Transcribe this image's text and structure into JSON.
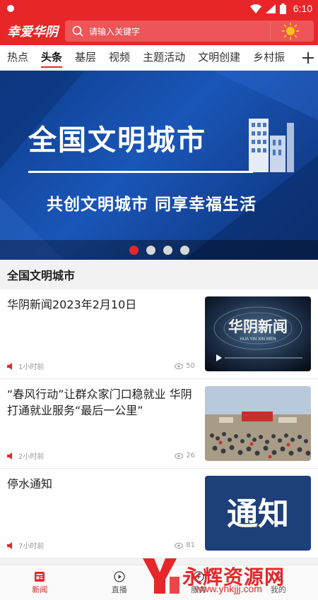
{
  "status_bar": {
    "time": "6:10"
  },
  "header": {
    "logo_text": "幸爱华阴",
    "search_placeholder": "请输入关键字"
  },
  "tabs": [
    {
      "label": "热点"
    },
    {
      "label": "头条",
      "active": true
    },
    {
      "label": "基层"
    },
    {
      "label": "视频"
    },
    {
      "label": "主题活动"
    },
    {
      "label": "文明创建"
    },
    {
      "label": "乡村振"
    }
  ],
  "banner": {
    "title": "全国文明城市",
    "subtitle": "共创文明城市 同享幸福生活",
    "page_count": 4,
    "active_page": 1
  },
  "section": {
    "title": "全国文明城市"
  },
  "news": [
    {
      "title": "华阴新闻2023年2月10日",
      "time": "1小时前",
      "views": "50",
      "thumb_text": "华阴新闻",
      "thumb_sub": "HUA YIN XIN WEN"
    },
    {
      "title": "“春风行动”让群众家门口稳就业 华阴打通就业服务“最后一公里”",
      "time": "2小时前",
      "views": "26"
    },
    {
      "title": "停水通知",
      "time": "7小时前",
      "views": "81",
      "thumb_text": "通知"
    }
  ],
  "bottom_nav": [
    {
      "label": "新闻",
      "icon": "news-icon",
      "active": true
    },
    {
      "label": "直播",
      "icon": "play-icon"
    },
    {
      "label": "服务",
      "icon": "service-icon"
    },
    {
      "label": "我的",
      "icon": "user-icon"
    }
  ],
  "watermark": {
    "text": "永辉资源网",
    "url": "www.yhkjjj.com"
  },
  "colors": {
    "brand_red": "#e8262a",
    "banner_blue": "#1a56b8"
  }
}
